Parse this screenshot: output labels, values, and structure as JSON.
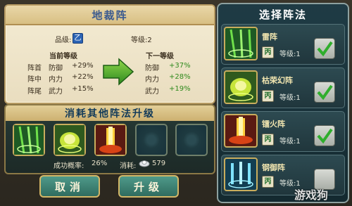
{
  "formation_panel": {
    "title": "地裁阵",
    "grade_label": "品级:",
    "grade_value": "乙",
    "level_label": "等级:2",
    "current_header": "当前等级",
    "next_header": "下一等级",
    "rows": [
      {
        "pos": "阵首",
        "attr": "防御",
        "current": "+29%",
        "next_attr": "防御",
        "next": "+37%"
      },
      {
        "pos": "阵中",
        "attr": "内力",
        "current": "+22%",
        "next_attr": "内力",
        "next": "+28%"
      },
      {
        "pos": "阵尾",
        "attr": "武力",
        "current": "+15%",
        "next_attr": "武力",
        "next": "+19%"
      }
    ]
  },
  "consume_panel": {
    "title": "消耗其他阵法升级",
    "success_label": "成功概率:",
    "success_value": "26%",
    "cost_label": "消耗:",
    "cost_value": "579"
  },
  "buttons": {
    "cancel": "取消",
    "upgrade": "升级"
  },
  "select_panel": {
    "title": "选择阵法",
    "formations": [
      {
        "name": "雷阵",
        "grade": "丙",
        "level": "等级:1",
        "checked": true
      },
      {
        "name": "枯荣幻阵",
        "grade": "丙",
        "level": "等级:1",
        "checked": true
      },
      {
        "name": "镭火阵",
        "grade": "丙",
        "level": "等级:1",
        "checked": true
      },
      {
        "name": "钢御阵",
        "grade": "丙",
        "level": "等级:1",
        "checked": false
      }
    ]
  },
  "watermark": "游戏狗",
  "colors": {
    "accent_green": "#2f8a1d",
    "check_green": "#2fae2c",
    "grade_blue": "#2b63b4"
  }
}
